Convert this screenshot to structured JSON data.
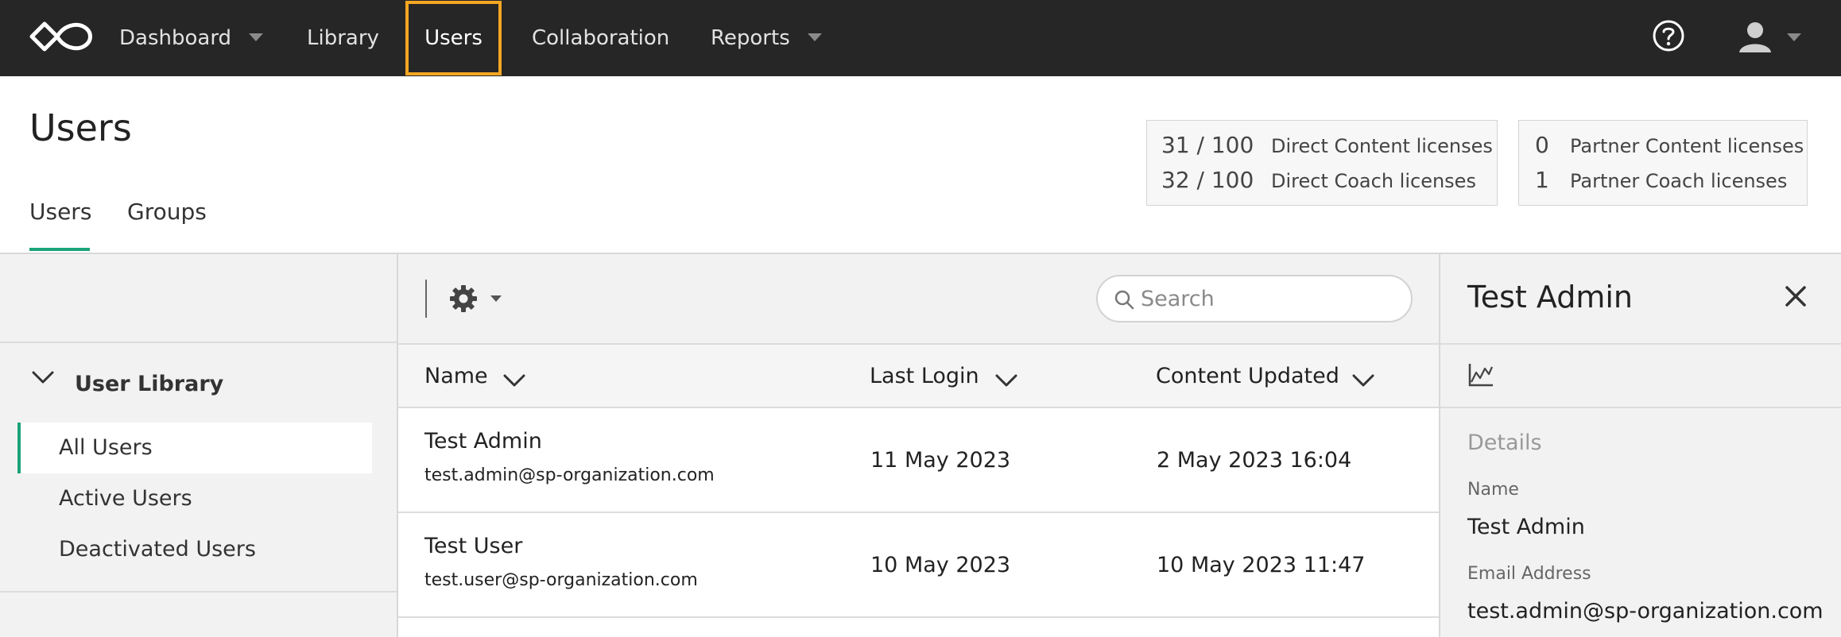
{
  "nav": {
    "items": [
      {
        "label": "Dashboard"
      },
      {
        "label": "Library"
      },
      {
        "label": "Users"
      },
      {
        "label": "Collaboration"
      },
      {
        "label": "Reports"
      }
    ],
    "active_highlight_color": "#f5a623",
    "icons": {
      "logo": "infinity-logo",
      "help": "help-circle-icon",
      "user": "user-avatar-icon"
    }
  },
  "header": {
    "title": "Users",
    "tabs": [
      {
        "label": "Users"
      },
      {
        "label": "Groups"
      }
    ],
    "accent_color": "#1aa37a"
  },
  "licenses": {
    "direct": [
      {
        "count": "31 / 100",
        "label": "Direct Content licenses"
      },
      {
        "count": "32 / 100",
        "label": "Direct Coach licenses"
      }
    ],
    "partner": [
      {
        "count": "0",
        "label": "Partner Content licenses"
      },
      {
        "count": "1",
        "label": "Partner Coach licenses"
      }
    ]
  },
  "sidebar": {
    "heading": "User Library",
    "items": [
      {
        "label": "All Users"
      },
      {
        "label": "Active Users"
      },
      {
        "label": "Deactivated Users"
      }
    ]
  },
  "toolbar": {
    "search_placeholder": "Search"
  },
  "table": {
    "columns": [
      {
        "label": "Name"
      },
      {
        "label": "Last Login"
      },
      {
        "label": "Content Updated"
      }
    ],
    "rows": [
      {
        "name": "Test Admin",
        "email": "test.admin@sp-organization.com",
        "last_login": "11 May 2023",
        "content_updated": "2 May 2023 16:04"
      },
      {
        "name": "Test User",
        "email": "test.user@sp-organization.com",
        "last_login": "10 May 2023",
        "content_updated": "10 May 2023 11:47"
      }
    ]
  },
  "panel": {
    "title": "Test Admin",
    "section": "Details",
    "fields": [
      {
        "label": "Name",
        "value": "Test Admin"
      },
      {
        "label": "Email Address",
        "value": "test.admin@sp-organization.com"
      }
    ]
  }
}
